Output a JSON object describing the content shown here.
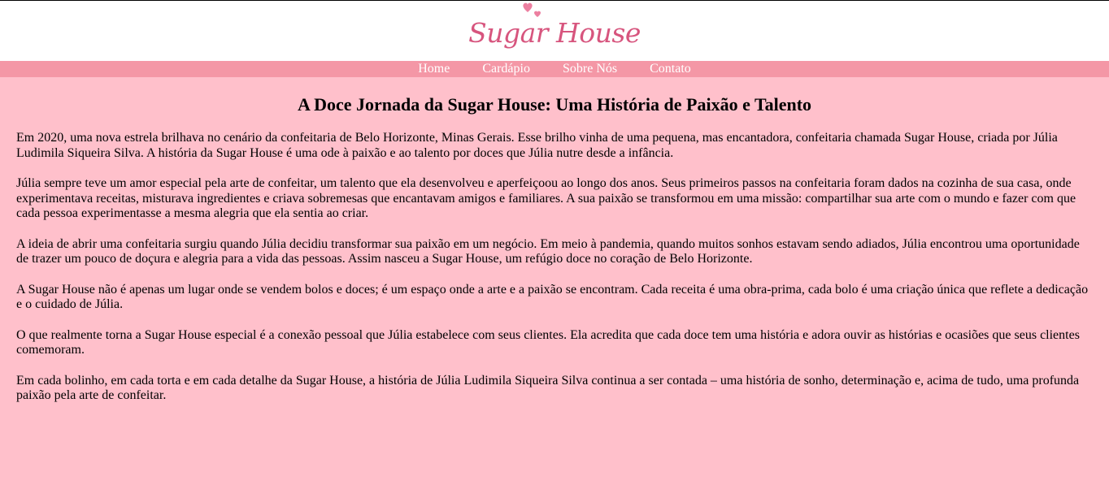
{
  "brand": {
    "logo_text": "Sugar House",
    "accent_color": "#d7557e",
    "nav_color": "#f497a6",
    "background_color": "#ffc0cb"
  },
  "nav": {
    "items": [
      {
        "label": "Home"
      },
      {
        "label": "Cardápio"
      },
      {
        "label": "Sobre Nós"
      },
      {
        "label": "Contato"
      }
    ]
  },
  "main": {
    "title": "A Doce Jornada da Sugar House: Uma História de Paixão e Talento",
    "paragraphs": [
      "Em 2020, uma nova estrela brilhava no cenário da confeitaria de Belo Horizonte, Minas Gerais. Esse brilho vinha de uma pequena, mas encantadora, confeitaria chamada Sugar House, criada por Júlia Ludimila Siqueira Silva. A história da Sugar House é uma ode à paixão e ao talento por doces que Júlia nutre desde a infância.",
      "Júlia sempre teve um amor especial pela arte de confeitar, um talento que ela desenvolveu e aperfeiçoou ao longo dos anos. Seus primeiros passos na confeitaria foram dados na cozinha de sua casa, onde experimentava receitas, misturava ingredientes e criava sobremesas que encantavam amigos e familiares. A sua paixão se transformou em uma missão: compartilhar sua arte com o mundo e fazer com que cada pessoa experimentasse a mesma alegria que ela sentia ao criar.",
      "A ideia de abrir uma confeitaria surgiu quando Júlia decidiu transformar sua paixão em um negócio. Em meio à pandemia, quando muitos sonhos estavam sendo adiados, Júlia encontrou uma oportunidade de trazer um pouco de doçura e alegria para a vida das pessoas. Assim nasceu a Sugar House, um refúgio doce no coração de Belo Horizonte.",
      "A Sugar House não é apenas um lugar onde se vendem bolos e doces; é um espaço onde a arte e a paixão se encontram. Cada receita é uma obra-prima, cada bolo é uma criação única que reflete a dedicação e o cuidado de Júlia.",
      "O que realmente torna a Sugar House especial é a conexão pessoal que Júlia estabelece com seus clientes. Ela acredita que cada doce tem uma história e adora ouvir as histórias e ocasiões que seus clientes comemoram.",
      "Em cada bolinho, em cada torta e em cada detalhe da Sugar House, a história de Júlia Ludimila Siqueira Silva continua a ser contada – uma história de sonho, determinação e, acima de tudo, uma profunda paixão pela arte de confeitar."
    ]
  }
}
